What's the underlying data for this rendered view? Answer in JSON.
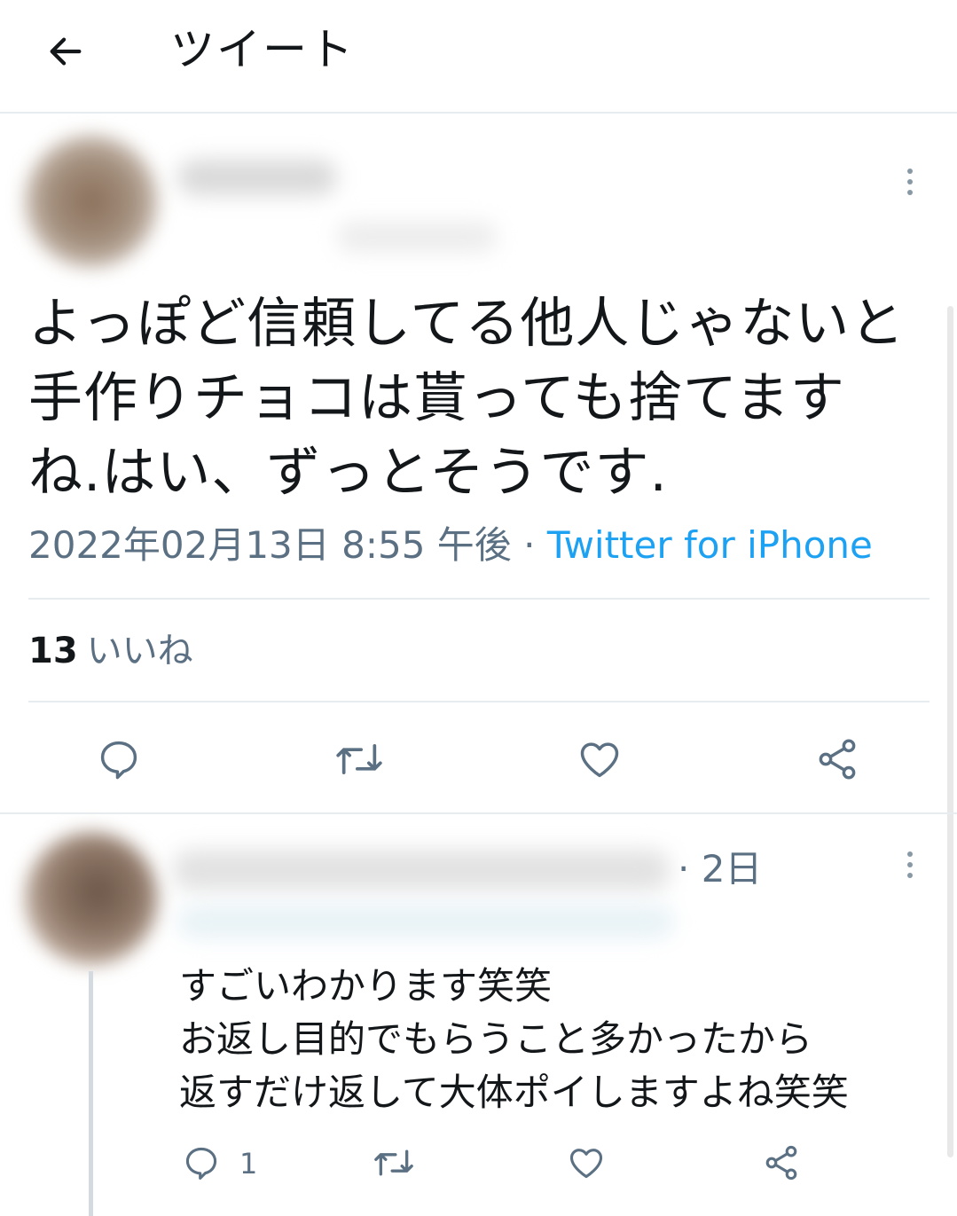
{
  "header": {
    "back_icon": "arrow-left-icon",
    "title": "ツイート"
  },
  "tweet": {
    "text": "よっぽど信頼してる他人じゃないと\n手作りチョコは貰っても捨てます\nね.はい、ずっとそうです.",
    "timestamp": "2022年02月13日 8:55 午後",
    "separator": " · ",
    "source": "Twitter for iPhone",
    "likes_count": "13",
    "likes_label": "いいね",
    "actions": [
      "reply-icon",
      "retweet-icon",
      "like-icon",
      "share-icon"
    ]
  },
  "reply": {
    "time": "· 2日",
    "text": "すごいわかります笑笑\nお返し目的でもらうこと多かったから\n返すだけ返して大体ポイしますよね笑笑",
    "reply_count": "1",
    "actions": [
      "reply-icon",
      "retweet-icon",
      "like-icon",
      "share-icon"
    ]
  },
  "colors": {
    "text": "#14171a",
    "secondary": "#5b7083",
    "link": "#1da1f2",
    "divider": "#e6ecf0"
  }
}
